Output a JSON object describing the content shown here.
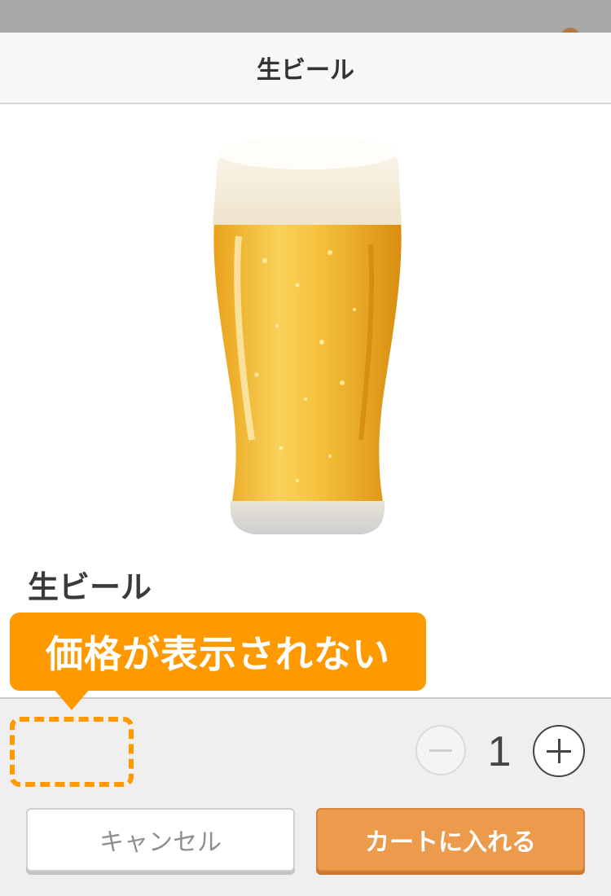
{
  "header": {
    "title": "生ビール"
  },
  "product": {
    "name": "生ビール",
    "image_icon": "beer-glass-image"
  },
  "annotation": {
    "callout_text": "価格が表示されない"
  },
  "quantity": {
    "value": "1",
    "decrease_icon": "minus-icon",
    "increase_icon": "plus-icon"
  },
  "actions": {
    "cancel_label": "キャンセル",
    "add_to_cart_label": "カートに入れる"
  },
  "colors": {
    "accent": "#ff9900",
    "cart_button": "#ec9b4c"
  }
}
